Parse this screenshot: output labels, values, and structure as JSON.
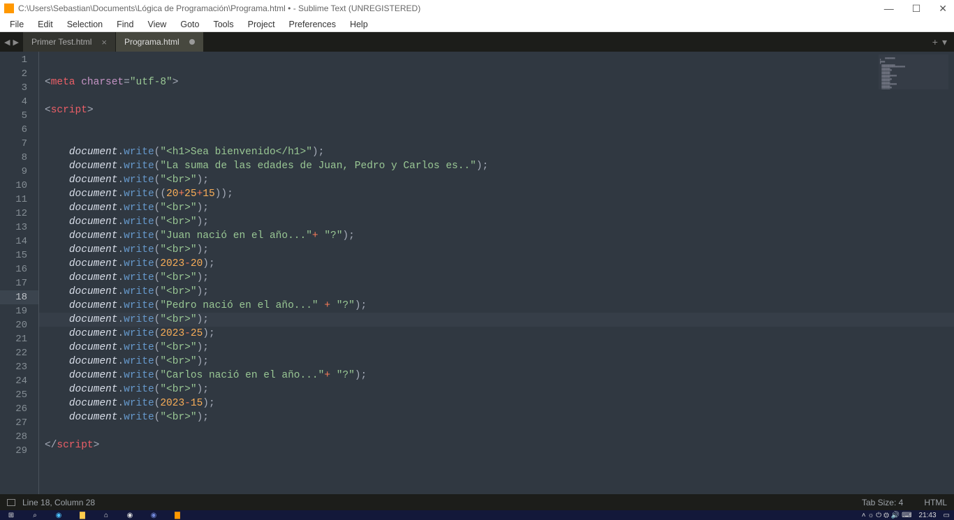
{
  "window": {
    "title": "C:\\Users\\Sebastian\\Documents\\Lógica de Programación\\Programa.html • - Sublime Text (UNREGISTERED)"
  },
  "menu": {
    "file": "File",
    "edit": "Edit",
    "selection": "Selection",
    "find": "Find",
    "view": "View",
    "goto": "Goto",
    "tools": "Tools",
    "project": "Project",
    "preferences": "Preferences",
    "help": "Help"
  },
  "tabs": {
    "tab1": "Primer Test.html",
    "tab2": "Programa.html"
  },
  "status": {
    "position": "Line 18, Column 28",
    "tab_size": "Tab Size: 4",
    "syntax": "HTML"
  },
  "taskbar": {
    "time": "21:43"
  },
  "line_numbers": [
    "1",
    "2",
    "3",
    "4",
    "5",
    "6",
    "7",
    "8",
    "9",
    "10",
    "11",
    "12",
    "13",
    "14",
    "15",
    "16",
    "17",
    "18",
    "19",
    "20",
    "21",
    "22",
    "23",
    "24",
    "25",
    "26",
    "27",
    "28",
    "29"
  ],
  "active_line": 18,
  "code": {
    "l1": {
      "a": "<",
      "b": "meta",
      "c": " ",
      "d": "charset",
      "e": "=",
      "f": "\"utf-8\"",
      "g": ">"
    },
    "l3": {
      "a": "<",
      "b": "script",
      "c": ">"
    },
    "l6": {
      "ind": "    ",
      "v": "document",
      "dot": ".",
      "fn": "write",
      "op1": "(",
      "s": "\"<h1>Sea bienvenido</h1>\"",
      "op2": ")",
      "end": ";"
    },
    "l7": {
      "ind": "    ",
      "v": "document",
      "dot": ".",
      "fn": "write",
      "op1": "(",
      "s": "\"La suma de las edades de Juan, Pedro y Carlos es..\"",
      "op2": ")",
      "end": ";"
    },
    "l8": {
      "ind": "    ",
      "v": "document",
      "dot": ".",
      "fn": "write",
      "op1": "(",
      "s": "\"<br>\"",
      "op2": ")",
      "end": ";"
    },
    "l9": {
      "ind": "    ",
      "v": "document",
      "dot": ".",
      "fn": "write",
      "op1": "((",
      "n1": "20",
      "plus1": "+",
      "n2": "25",
      "plus2": "+",
      "n3": "15",
      "op2": "))",
      "end": ";"
    },
    "l10": {
      "ind": "    ",
      "v": "document",
      "dot": ".",
      "fn": "write",
      "op1": "(",
      "s": "\"<br>\"",
      "op2": ")",
      "end": ";"
    },
    "l11": {
      "ind": "    ",
      "v": "document",
      "dot": ".",
      "fn": "write",
      "op1": "(",
      "s": "\"<br>\"",
      "op2": ")",
      "end": ";"
    },
    "l12": {
      "ind": "    ",
      "v": "document",
      "dot": ".",
      "fn": "write",
      "op1": "(",
      "s": "\"Juan nació en el año...\"",
      "plus": "+",
      "sp": " ",
      "s2": "\"?\"",
      "op2": ")",
      "end": ";"
    },
    "l13": {
      "ind": "    ",
      "v": "document",
      "dot": ".",
      "fn": "write",
      "op1": "(",
      "s": "\"<br>\"",
      "op2": ")",
      "end": ";"
    },
    "l14": {
      "ind": "    ",
      "v": "document",
      "dot": ".",
      "fn": "write",
      "op1": "(",
      "n1": "2023",
      "minus": "-",
      "n2": "20",
      "op2": ")",
      "end": ";"
    },
    "l15": {
      "ind": "    ",
      "v": "document",
      "dot": ".",
      "fn": "write",
      "op1": "(",
      "s": "\"<br>\"",
      "op2": ")",
      "end": ";"
    },
    "l16": {
      "ind": "    ",
      "v": "document",
      "dot": ".",
      "fn": "write",
      "op1": "(",
      "s": "\"<br>\"",
      "op2": ")",
      "end": ";"
    },
    "l17": {
      "ind": "    ",
      "v": "document",
      "dot": ".",
      "fn": "write",
      "op1": "(",
      "s": "\"Pedro nació en el año...\"",
      "sp1": " ",
      "plus": "+",
      "sp2": " ",
      "s2": "\"?\"",
      "op2": ")",
      "end": ";"
    },
    "l18": {
      "ind": "    ",
      "v": "document",
      "dot": ".",
      "fn": "write",
      "op1": "(",
      "s": "\"<br>\"",
      "op2": ")",
      "end": ";"
    },
    "l19": {
      "ind": "    ",
      "v": "document",
      "dot": ".",
      "fn": "write",
      "op1": "(",
      "n1": "2023",
      "minus": "-",
      "n2": "25",
      "op2": ")",
      "end": ";"
    },
    "l20": {
      "ind": "    ",
      "v": "document",
      "dot": ".",
      "fn": "write",
      "op1": "(",
      "s": "\"<br>\"",
      "op2": ")",
      "end": ";"
    },
    "l21": {
      "ind": "    ",
      "v": "document",
      "dot": ".",
      "fn": "write",
      "op1": "(",
      "s": "\"<br>\"",
      "op2": ")",
      "end": ";"
    },
    "l22": {
      "ind": "    ",
      "v": "document",
      "dot": ".",
      "fn": "write",
      "op1": "(",
      "s": "\"Carlos nació en el año...\"",
      "plus": "+",
      "sp": " ",
      "s2": "\"?\"",
      "op2": ")",
      "end": ";"
    },
    "l23": {
      "ind": "    ",
      "v": "document",
      "dot": ".",
      "fn": "write",
      "op1": "(",
      "s": "\"<br>\"",
      "op2": ")",
      "end": ";"
    },
    "l24": {
      "ind": "    ",
      "v": "document",
      "dot": ".",
      "fn": "write",
      "op1": "(",
      "n1": "2023",
      "minus": "-",
      "n2": "15",
      "op2": ")",
      "end": ";"
    },
    "l25": {
      "ind": "    ",
      "v": "document",
      "dot": ".",
      "fn": "write",
      "op1": "(",
      "s": "\"<br>\"",
      "op2": ")",
      "end": ";"
    },
    "l27": {
      "a": "</",
      "b": "script",
      "c": ">"
    }
  }
}
